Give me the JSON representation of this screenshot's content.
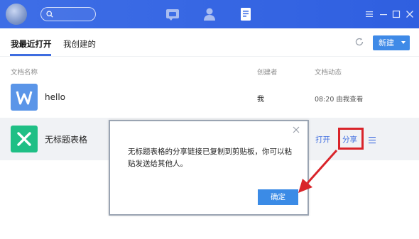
{
  "titlebar": {
    "search_placeholder": "",
    "nav_icons": [
      "chat-icon",
      "contacts-icon",
      "document-icon"
    ],
    "window_controls": [
      "menu-icon",
      "minimize-icon",
      "maximize-icon",
      "close-icon"
    ],
    "bg_color": "#3e6ee6"
  },
  "tabs": {
    "recent_label": "我最近打开",
    "created_label": "我创建的",
    "new_button_label": "新建"
  },
  "columns": {
    "name": "文档名称",
    "creator": "创建者",
    "activity": "文档动态"
  },
  "files": [
    {
      "name": "hello",
      "icon": "word-doc-icon",
      "icon_color": "#5a95e8",
      "creator": "我",
      "activity": "08:20 由我查看"
    },
    {
      "name": "无标题表格",
      "icon": "sheet-icon",
      "icon_color": "#1fbf85",
      "creator": "",
      "activity": ""
    }
  ],
  "row_actions": {
    "open_label": "打开",
    "share_label": "分享"
  },
  "dialog": {
    "message": "无标题表格的分享链接已复制到剪贴板，你可以粘贴发送给其他人。",
    "confirm_label": "确定"
  },
  "colors": {
    "accent": "#3f6de0",
    "highlight": "#d9242a",
    "button": "#3b8be6"
  }
}
